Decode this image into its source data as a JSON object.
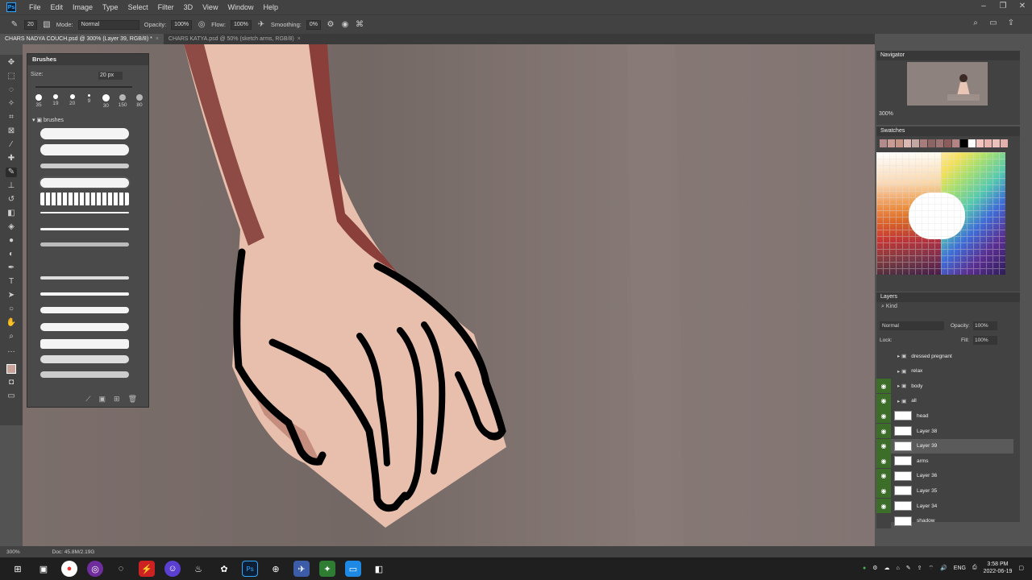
{
  "menu": [
    "File",
    "Edit",
    "Image",
    "Type",
    "Select",
    "Filter",
    "3D",
    "View",
    "Window",
    "Help"
  ],
  "app_logo": "Ps",
  "options": {
    "mode_label": "Mode:",
    "mode_value": "Normal",
    "opacity_label": "Opacity:",
    "opacity_value": "100%",
    "flow_label": "Flow:",
    "flow_value": "100%",
    "smoothing_label": "Smoothing:",
    "smoothing_value": "0%",
    "brush_size": "20"
  },
  "tabs": [
    {
      "label": "CHARS NADYA COUCH.psd @ 300% (Layer 39, RGB/8) *",
      "active": true
    },
    {
      "label": "CHARS KATYA.psd @ 50% (sketch arms, RGB/8)",
      "active": false
    }
  ],
  "brushes_panel": {
    "title": "Brushes",
    "size_label": "Size:",
    "size_value": "20 px",
    "presets": [
      "35",
      "19",
      "20",
      "9",
      "30",
      "150",
      "80"
    ],
    "folder": "brushes"
  },
  "navigator": {
    "title": "Navigator",
    "zoom": "300%"
  },
  "swatches": {
    "title": "Swatches",
    "colors": [
      "#b28c8c",
      "#c89c94",
      "#c69484",
      "#dcb8b2",
      "#c4a6a2",
      "#a87c7c",
      "#8c6464",
      "#9c7474",
      "#8c5c5c",
      "#b48484",
      "#000000",
      "#ffffff",
      "#f4c4c0",
      "#e8b4b0",
      "#ecc0bc",
      "#e4b0ac"
    ]
  },
  "layers": {
    "title": "Layers",
    "kind": "Kind",
    "blend": "Normal",
    "opacity_label": "Opacity:",
    "opacity_value": "100%",
    "lock_label": "Lock:",
    "fill_label": "Fill:",
    "fill_value": "100%",
    "rows": [
      {
        "name": "dressed pregnant",
        "visible": false,
        "group": true
      },
      {
        "name": "relax",
        "visible": false,
        "group": true
      },
      {
        "name": "body",
        "visible": true,
        "group": true
      },
      {
        "name": "all",
        "visible": true,
        "group": true
      },
      {
        "name": "head",
        "visible": true
      },
      {
        "name": "Layer 38",
        "visible": true
      },
      {
        "name": "Layer 39",
        "visible": true,
        "selected": true
      },
      {
        "name": "arms",
        "visible": true
      },
      {
        "name": "Layer 36",
        "visible": true
      },
      {
        "name": "Layer 35",
        "visible": true
      },
      {
        "name": "Layer 34",
        "visible": true
      },
      {
        "name": "shadow",
        "visible": false
      }
    ]
  },
  "status": {
    "zoom": "300%",
    "doc": "Doc: 45.8M/2.19G"
  },
  "taskbar": {
    "lang": "ENG",
    "time": "3:58 PM",
    "date": "2022-06-19"
  }
}
